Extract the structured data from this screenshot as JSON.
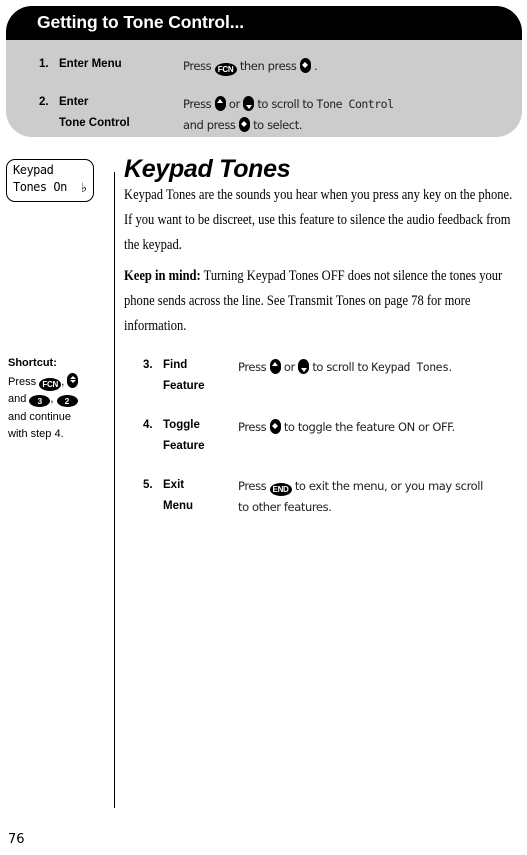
{
  "callout": {
    "title": "Getting to Tone Control...",
    "bg_color": "#cccccc",
    "header_color": "#000000",
    "steps": [
      {
        "number": "1.",
        "label_line1": "Enter Menu",
        "label_line2": "",
        "desc_line1_a": "Press",
        "desc_line1_key": "FCN",
        "desc_line1_b": "then press",
        "desc_line1_c": ".",
        "desc_line2": ""
      },
      {
        "number": "2.",
        "label_line1": "Enter",
        "label_line2": "Tone Control",
        "desc_line1_a": "Press",
        "desc_line1_b": "or",
        "desc_line1_c": "to scroll to",
        "desc_line1_lcd": "Tone Control",
        "desc_line2_a": "and press",
        "desc_line2_b": "to select."
      }
    ]
  },
  "lcd": {
    "line1": "Keypad",
    "line2": "Tones On",
    "bell_icon": "bell-icon"
  },
  "main": {
    "heading": "Keypad Tones",
    "paragraph_1": "Keypad Tones are the sounds you hear when you press any key on the phone. If you want to be discreet, use this feature to silence the audio feedback from the keypad.",
    "paragraph_2_lead": "Keep in mind:",
    "paragraph_2_rest": " Turning Keypad Tones OFF does not silence the tones your phone sends across the line. See Transmit Tones on page 78 for more information."
  },
  "shortcut": {
    "title": "Shortcut:",
    "line1_a": "Press",
    "line1_key": "FCN",
    "line1_comma": ",",
    "line2_a": "and",
    "line2_key1": "3",
    "line2_comma": ",",
    "line2_key2": "2",
    "line3": "and continue",
    "line4": "with step 4."
  },
  "steps_lower": [
    {
      "number": "3.",
      "label_line1": "Find",
      "label_line2": "Feature",
      "desc_a": "Press",
      "desc_b": "or",
      "desc_c": "to scroll to",
      "desc_lcd": "Keypad Tones",
      "desc_d": "."
    },
    {
      "number": "4.",
      "label_line1": "Toggle",
      "label_line2": "Feature",
      "desc_a": "Press",
      "desc_b": "to toggle the feature ON or OFF."
    },
    {
      "number": "5.",
      "label_line1": "Exit",
      "label_line2": "Menu",
      "desc_a": "Press",
      "desc_key": "END",
      "desc_b": "to exit the menu, or you may scroll",
      "desc_line2": "to other features."
    }
  ],
  "footer": {
    "page_number": "76"
  }
}
